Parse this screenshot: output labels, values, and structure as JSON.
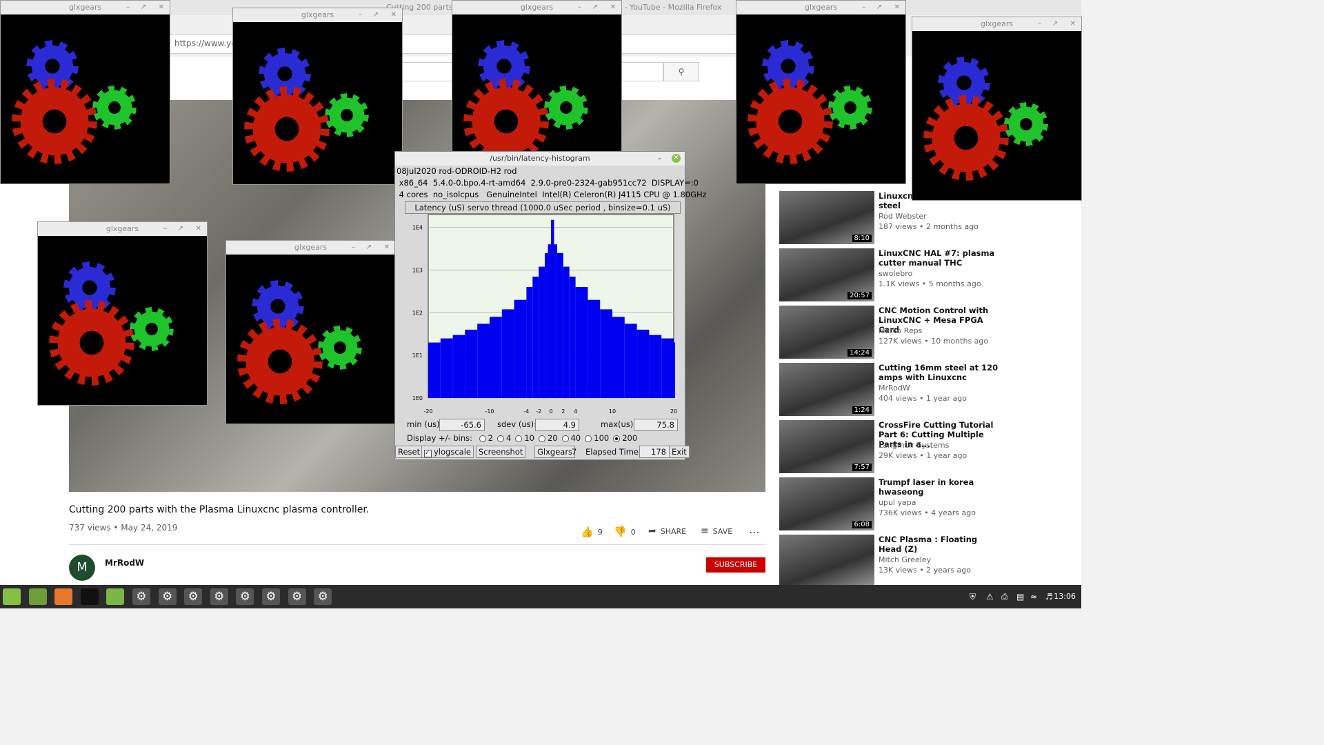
{
  "firefox": {
    "window_title": "Cutting 200 parts with the Plasma Linuxcnc plasma controller. - YouTube - Mozilla Firefox",
    "url": "https://www.you",
    "search_icon": "search-icon"
  },
  "video": {
    "title": "Cutting 200 parts with the Plasma Linuxcnc plasma controller.",
    "meta": "737 views • May 24, 2019",
    "likes": "9",
    "dislikes": "0",
    "share": "SHARE",
    "save": "SAVE",
    "channel": "MrRodW",
    "channel_initial": "M",
    "subscribe": "SUBSCRIBE"
  },
  "sidebar": {
    "partial_title": "Linuxcnc ... from 2mm mild steel",
    "items": [
      {
        "title": "Linuxcnc\nfrom 2mm mild steel",
        "channel": "Rod Webster",
        "meta": "187 views • 2 months ago",
        "duration": "8:10"
      },
      {
        "title": "LinuxCNC HAL #7: plasma cutter manual THC",
        "channel": "swolebro",
        "meta": "1.1K views • 5 months ago",
        "duration": "20:57"
      },
      {
        "title": "CNC Motion Control with LinuxCNC + Mesa FPGA Card",
        "channel": "Marco Reps",
        "meta": "127K views • 10 months ago",
        "duration": "14:24"
      },
      {
        "title": "Cutting 16mm steel at 120 amps with Linuxcnc",
        "channel": "MrRodW",
        "meta": "404 views • 1 year ago",
        "duration": "1:24"
      },
      {
        "title": "CrossFire Cutting Tutorial Part 6: Cutting Multiple Parts in a...",
        "channel": "Langmuir Systems",
        "meta": "29K views • 1 year ago",
        "duration": "7:57"
      },
      {
        "title": "Trumpf laser in korea hwaseong",
        "channel": "upul yapa",
        "meta": "736K views • 4 years ago",
        "duration": "6:08"
      },
      {
        "title": "CNC Plasma : Floating Head (Z)",
        "channel": "Mitch Greeley",
        "meta": "13K views • 2 years ago",
        "duration": ""
      }
    ]
  },
  "glx": {
    "title": "glxgears"
  },
  "latency": {
    "window_title": "/usr/bin/latency-histogram",
    "line1": "08Jul2020 rod-ODROID-H2 rod",
    "line2": " x86_64  5.4.0-0.bpo.4-rt-amd64  2.9.0-pre0-2324-gab951cc72  DISPLAY=:0",
    "line3": " 4 cores  no_isolcpus   GenuineIntel  Intel(R) Celeron(R) J4115 CPU @ 1.80GHz",
    "plot_title": "Latency (uS) servo thread (1000.0 uSec period , binsize=0.1 uS)",
    "min_label": "min (us)",
    "min_value": "-65.6",
    "sdev_label": "sdev (us):",
    "sdev_value": "4.9",
    "max_label": "max(us)",
    "max_value": "75.8",
    "bins_label": "Display +/- bins:",
    "bins_options": [
      "2",
      "4",
      "10",
      "20",
      "40",
      "100",
      "200"
    ],
    "bins_selected": "200",
    "reset": "Reset",
    "ylogscale": "ylogscale",
    "screenshot": "Screenshot",
    "glxgears": "Glxgears",
    "glxgears_count": "7",
    "elapsed_label": "Elapsed Time:",
    "elapsed_value": "178",
    "exit": "Exit"
  },
  "chart_data": {
    "type": "bar",
    "title": "Latency (uS) servo thread (1000.0 uSec period , binsize=0.1 uS)",
    "x_ticks": [
      "-20",
      "-10",
      "-4",
      "-2",
      "0",
      "2",
      "4",
      "10",
      "20"
    ],
    "y_ticks": [
      "1E0",
      "1E1",
      "1E2",
      "1E3",
      "1E4"
    ],
    "xlim": [
      -20,
      20
    ],
    "ylim": [
      1,
      20000
    ],
    "yscale": "log",
    "series": [
      {
        "x": [
          -20,
          -18,
          -16,
          -14,
          -12,
          -10,
          -8,
          -6,
          -4,
          -3,
          -2,
          -1,
          -0.5,
          0,
          0.5,
          1,
          2,
          3,
          4,
          6,
          8,
          10,
          12,
          14,
          16,
          18,
          20
        ],
        "values": [
          20,
          25,
          30,
          40,
          55,
          80,
          120,
          200,
          400,
          700,
          1200,
          2500,
          4000,
          15000,
          4000,
          2500,
          1200,
          700,
          400,
          200,
          120,
          80,
          55,
          40,
          30,
          25,
          20
        ]
      }
    ]
  },
  "taskbar": {
    "clock": "13:06",
    "icons": [
      "mint-menu-icon",
      "show-desktop-icon",
      "firefox-icon",
      "terminal-icon",
      "files-icon",
      "gear-app-icon",
      "gear-app-icon",
      "gear-app-icon",
      "gear-app-icon",
      "gear-app-icon",
      "gear-app-icon",
      "gear-app-icon",
      "gear-app-icon"
    ]
  }
}
